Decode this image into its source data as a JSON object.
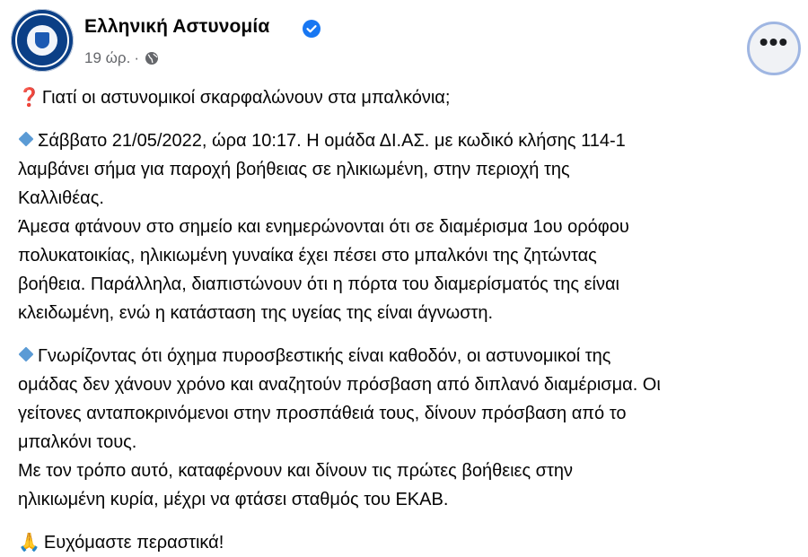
{
  "page": {
    "name": "Ελληνική Αστυνομία",
    "time": "19 ώρ.",
    "separator": "·",
    "audience_icon": "globe-icon",
    "verified_icon": "verified-badge-icon",
    "more_label": "•••"
  },
  "post": {
    "title_icon": "❓",
    "title": "Γιατί οι αστυνομικοί σκαρφαλώνουν στα μπαλκόνια;",
    "para1": [
      "Σάββατο 21/05/2022, ώρα 10:17. Η ομάδα ΔΙ.ΑΣ. με κωδικό κλήσης 114-1",
      "λαμβάνει σήμα για παροχή βοήθειας σε ηλικιωμένη, στην περιοχή της",
      "Καλλιθέας.",
      "Άμεσα φτάνουν στο σημείο και ενημερώνονται ότι σε διαμέρισμα 1ου ορόφου",
      "πολυκατοικίας, ηλικιωμένη γυναίκα έχει πέσει στο μπαλκόνι της ζητώντας",
      "βοήθεια. Παράλληλα, διαπιστώνουν ότι η  πόρτα του διαμερίσματός της είναι",
      "κλειδωμένη, ενώ η κατάσταση της υγείας της είναι άγνωστη."
    ],
    "para2": [
      "Γνωρίζοντας ότι όχημα πυροσβεστικής είναι καθοδόν, οι αστυνομικοί της",
      "ομάδας δεν χάνουν χρόνο και αναζητούν πρόσβαση από διπλανό διαμέρισμα. Οι",
      "γείτονες ανταποκρινόμενοι στην προσπάθειά τους, δίνουν πρόσβαση από το",
      "μπαλκόνι τους.",
      "Με τον τρόπο αυτό, καταφέρνουν και δίνουν τις πρώτες βοήθειες στην",
      "ηλικιωμένη κυρία, μέχρι να φτάσει σταθμός του ΕΚΑΒ."
    ],
    "closing_icon": "🙏",
    "closing": "Ευχόμαστε περαστικά!"
  }
}
